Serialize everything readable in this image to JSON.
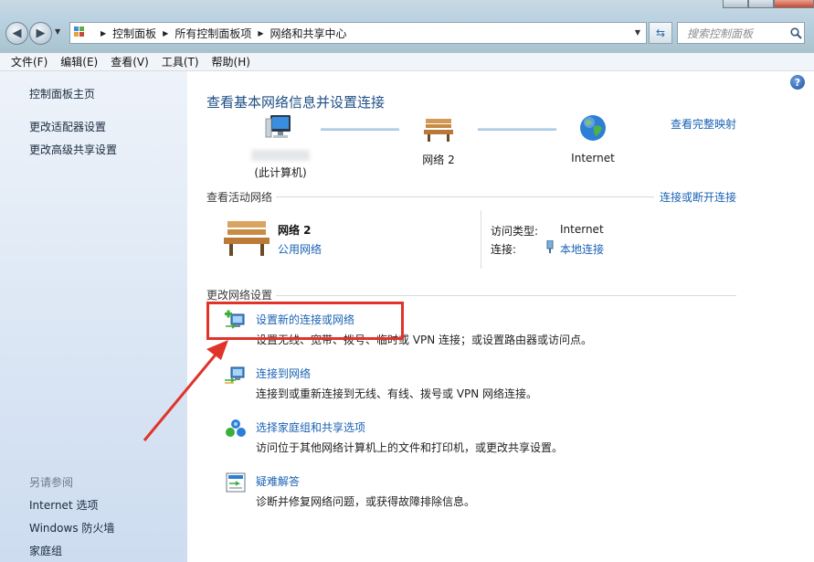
{
  "address_bar": {
    "crumbs": [
      "控制面板",
      "所有控制面板项",
      "网络和共享中心"
    ]
  },
  "search": {
    "placeholder": "搜索控制面板"
  },
  "menu": [
    {
      "label": "文件(F)"
    },
    {
      "label": "编辑(E)"
    },
    {
      "label": "查看(V)"
    },
    {
      "label": "工具(T)"
    },
    {
      "label": "帮助(H)"
    }
  ],
  "sidebar": {
    "links": [
      "控制面板主页",
      "更改适配器设置",
      "更改高级共享设置"
    ],
    "see_also_heading": "另请参阅",
    "see_also": [
      "Internet 选项",
      "Windows 防火墙",
      "家庭组"
    ]
  },
  "main": {
    "title": "查看基本网络信息并设置连接",
    "full_map_link": "查看完整映射",
    "map": {
      "computer_label": "(此计算机)",
      "network_label": "网络  2",
      "internet_label": "Internet"
    },
    "active_networks": {
      "heading": "查看活动网络",
      "link": "连接或断开连接",
      "network_name": "网络  2",
      "network_type": "公用网络",
      "access_type_label": "访问类型:",
      "access_type_value": "Internet",
      "connection_label": "连接:",
      "connection_value": "本地连接"
    },
    "change_settings": {
      "heading": "更改网络设置",
      "tasks": [
        {
          "title": "设置新的连接或网络",
          "desc": "设置无线、宽带、拨号、临时或 VPN 连接；或设置路由器或访问点。",
          "icon": "new-connection-icon"
        },
        {
          "title": "连接到网络",
          "desc": "连接到或重新连接到无线、有线、拨号或 VPN 网络连接。",
          "icon": "connect-network-icon"
        },
        {
          "title": "选择家庭组和共享选项",
          "desc": "访问位于其他网络计算机上的文件和打印机，或更改共享设置。",
          "icon": "homegroup-icon"
        },
        {
          "title": "疑难解答",
          "desc": "诊断并修复网络问题，或获得故障排除信息。",
          "icon": "troubleshoot-icon"
        }
      ]
    }
  },
  "colors": {
    "link": "#1a62b3",
    "title": "#1f4f86",
    "highlight": "#e0342a"
  }
}
